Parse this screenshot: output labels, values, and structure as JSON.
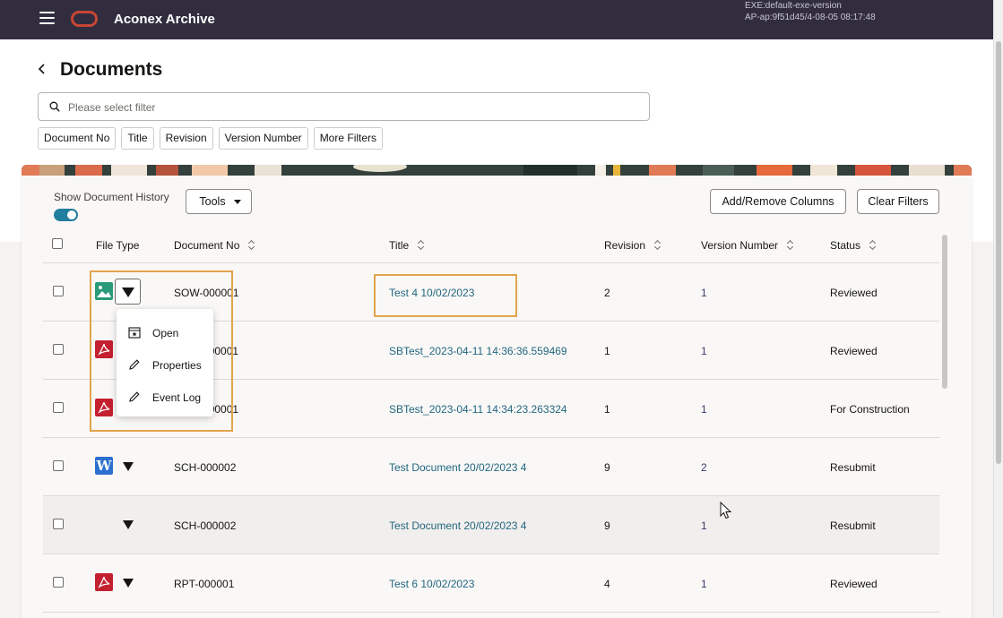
{
  "header": {
    "app_title": "Aconex Archive",
    "version_line1": "EXE:default-exe-version",
    "version_line2": "AP-ap:9f51d45/4-08-05 08:17:48"
  },
  "page": {
    "title": "Documents",
    "filter_placeholder": "Please select filter",
    "chips": [
      "Document No",
      "Title",
      "Revision",
      "Version Number",
      "More Filters"
    ]
  },
  "toolbar": {
    "history_label": "Show Document History",
    "history_on": true,
    "tools_label": "Tools",
    "add_remove_label": "Add/Remove Columns",
    "clear_filters_label": "Clear Filters"
  },
  "table": {
    "columns": {
      "file_type": "File Type",
      "document_no": "Document No",
      "title": "Title",
      "revision": "Revision",
      "version_number": "Version Number",
      "status": "Status"
    },
    "rows": [
      {
        "file_type": "image",
        "document_no": "SOW-000001",
        "title": "Test 4 10/02/2023",
        "revision": "2",
        "version": "1",
        "status": "Reviewed"
      },
      {
        "file_type": "pdf",
        "document_no": "S___-000001",
        "title": "SBTest_2023-04-11 14:36:36.559469",
        "revision": "1",
        "version": "1",
        "status": "Reviewed"
      },
      {
        "file_type": "pdf",
        "document_no": "S___-000001",
        "title": "SBTest_2023-04-11 14:34:23.263324",
        "revision": "1",
        "version": "1",
        "status": "For Construction"
      },
      {
        "file_type": "word",
        "document_no": "SCH-000002",
        "title": "Test Document 20/02/2023 4",
        "revision": "9",
        "version": "2",
        "status": "Resubmit"
      },
      {
        "file_type": "none",
        "document_no": "SCH-000002",
        "title": "Test Document 20/02/2023 4",
        "revision": "9",
        "version": "1",
        "status": "Resubmit"
      },
      {
        "file_type": "pdf",
        "document_no": "RPT-000001",
        "title": "Test 6 10/02/2023",
        "revision": "4",
        "version": "1",
        "status": "Reviewed"
      }
    ]
  },
  "context_menu": {
    "items": [
      {
        "label": "Open",
        "icon": "calendar-star-icon"
      },
      {
        "label": "Properties",
        "icon": "pencil-icon"
      },
      {
        "label": "Event Log",
        "icon": "pencil-icon"
      }
    ]
  },
  "colors": {
    "header_bg": "#312d3f",
    "accent": "#227e9e",
    "link": "#22657f",
    "highlight": "#e3a44d",
    "pdf": "#c32030",
    "image": "#2a9a7a",
    "word": "#2b6fcf"
  }
}
